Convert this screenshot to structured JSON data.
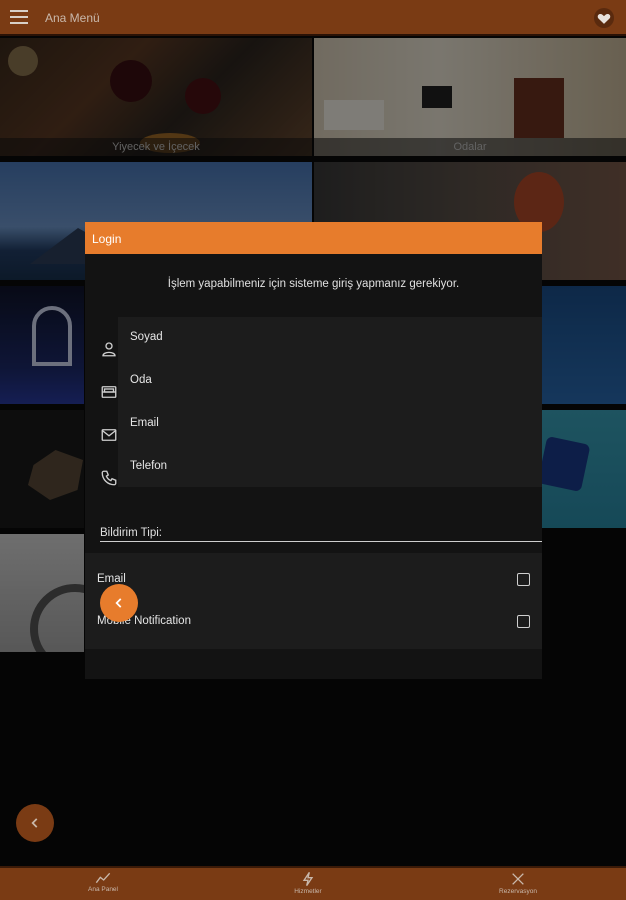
{
  "app_bar": {
    "title": "Ana Menü",
    "menu_icon": "hamburger-icon",
    "favorite_icon": "heart-icon"
  },
  "tiles": [
    {
      "name": "food-drink",
      "caption": "Yiyecek ve İçecek"
    },
    {
      "name": "rooms",
      "caption": "Odalar"
    }
  ],
  "dialog": {
    "title": "Login",
    "message": "İşlem yapabilmeniz için sisteme giriş yapmanız gerekiyor.",
    "fields": [
      {
        "label": "Soyad",
        "icon": "person-icon"
      },
      {
        "label": "Oda",
        "icon": "bed-icon"
      },
      {
        "label": "Email",
        "icon": "envelope-icon"
      },
      {
        "label": "Telefon",
        "icon": "phone-icon"
      }
    ],
    "notification_type_label": "Bildirim Tipi:",
    "notification_options": [
      {
        "label": "Email",
        "checked": false
      },
      {
        "label": "Mobile Notification",
        "checked": false
      }
    ]
  },
  "bottom_nav": [
    {
      "label": "Ana Panel",
      "icon": "chart-line-icon"
    },
    {
      "label": "Hizmetler",
      "icon": "lightning-icon"
    },
    {
      "label": "Rezervasyon",
      "icon": "utensils-icon"
    }
  ],
  "colors": {
    "primary": "#7a3b14",
    "accent": "#e77c2c",
    "background": "#0b0b0b",
    "dialog": "#131313"
  }
}
